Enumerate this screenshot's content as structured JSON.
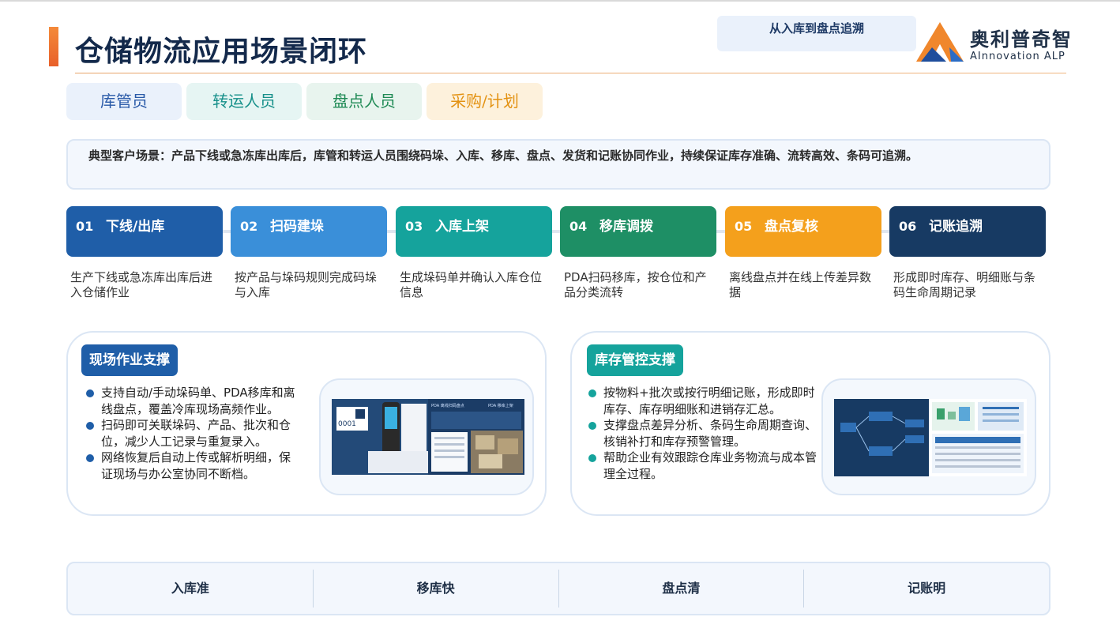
{
  "header": {
    "title": "仓储物流应用场景闭环",
    "tagline": "从入库到盘点追溯",
    "logo_cn": "奥利普奇智",
    "logo_en": "AInnovation ALP"
  },
  "roles": [
    {
      "label": "库管员",
      "bg": "#eaf1fb",
      "fg": "#2a5aa8"
    },
    {
      "label": "转运人员",
      "bg": "#e6f5f3",
      "fg": "#17908a"
    },
    {
      "label": "盘点人员",
      "bg": "#e8f4ee",
      "fg": "#1f8a55"
    },
    {
      "label": "采购/计划",
      "bg": "#fdf1dc",
      "fg": "#e39212"
    }
  ],
  "scenario": "典型客户场景：产品下线或急冻库出库后，库管和转运人员围绕码垛、入库、移库、盘点、发货和记账协同作业，持续保证库存准确、流转高效、条码可追溯。",
  "steps": [
    {
      "num": "01",
      "label": "下线/出库",
      "color": "#1f5ea8",
      "desc": "生产下线或急冻库出库后进入仓储作业"
    },
    {
      "num": "02",
      "label": "扫码建垛",
      "color": "#3a8fd9",
      "desc": "按产品与垛码规则完成码垛与入库"
    },
    {
      "num": "03",
      "label": "入库上架",
      "color": "#15a39c",
      "desc": "生成垛码单并确认入库仓位信息"
    },
    {
      "num": "04",
      "label": "移库调拨",
      "color": "#1e8f65",
      "desc": "PDA扫码移库，按仓位和产品分类流转"
    },
    {
      "num": "05",
      "label": "盘点复核",
      "color": "#f4a01c",
      "desc": "离线盘点并在线上传差异数据"
    },
    {
      "num": "06",
      "label": "记账追溯",
      "color": "#173a63",
      "desc": "形成即时库存、明细账与条码生命周期记录"
    }
  ],
  "panels": {
    "left": {
      "badge": "现场作业支撑",
      "badge_color": "#1f5ea8",
      "bullet_color": "#1f5ea8",
      "bullets": [
        "支持自动/手动垛码单、PDA移库和离线盘点，覆盖冷库现场高频作业。",
        "扫码即可关联垛码、产品、批次和仓位，减少人工记录与重复录入。",
        "网络恢复后自动上传或解析明细，保证现场与办公室协同不断档。"
      ],
      "shot_labels": [
        "0001",
        "PDA 离线扫码盘点",
        "PDA 移库上架"
      ]
    },
    "right": {
      "badge": "库存管控支撑",
      "badge_color": "#15a39c",
      "bullet_color": "#15a39c",
      "bullets": [
        "按物料+批次或按行明细记账，形成即时库存、库存明细账和进销存汇总。",
        "支撑盘点差异分析、条码生命周期查询、核销补打和库存预警管理。",
        "帮助企业有效跟踪仓库业务物流与成本管理全过程。"
      ]
    }
  },
  "bottom": [
    "入库准",
    "移库快",
    "盘点清",
    "记账明"
  ]
}
